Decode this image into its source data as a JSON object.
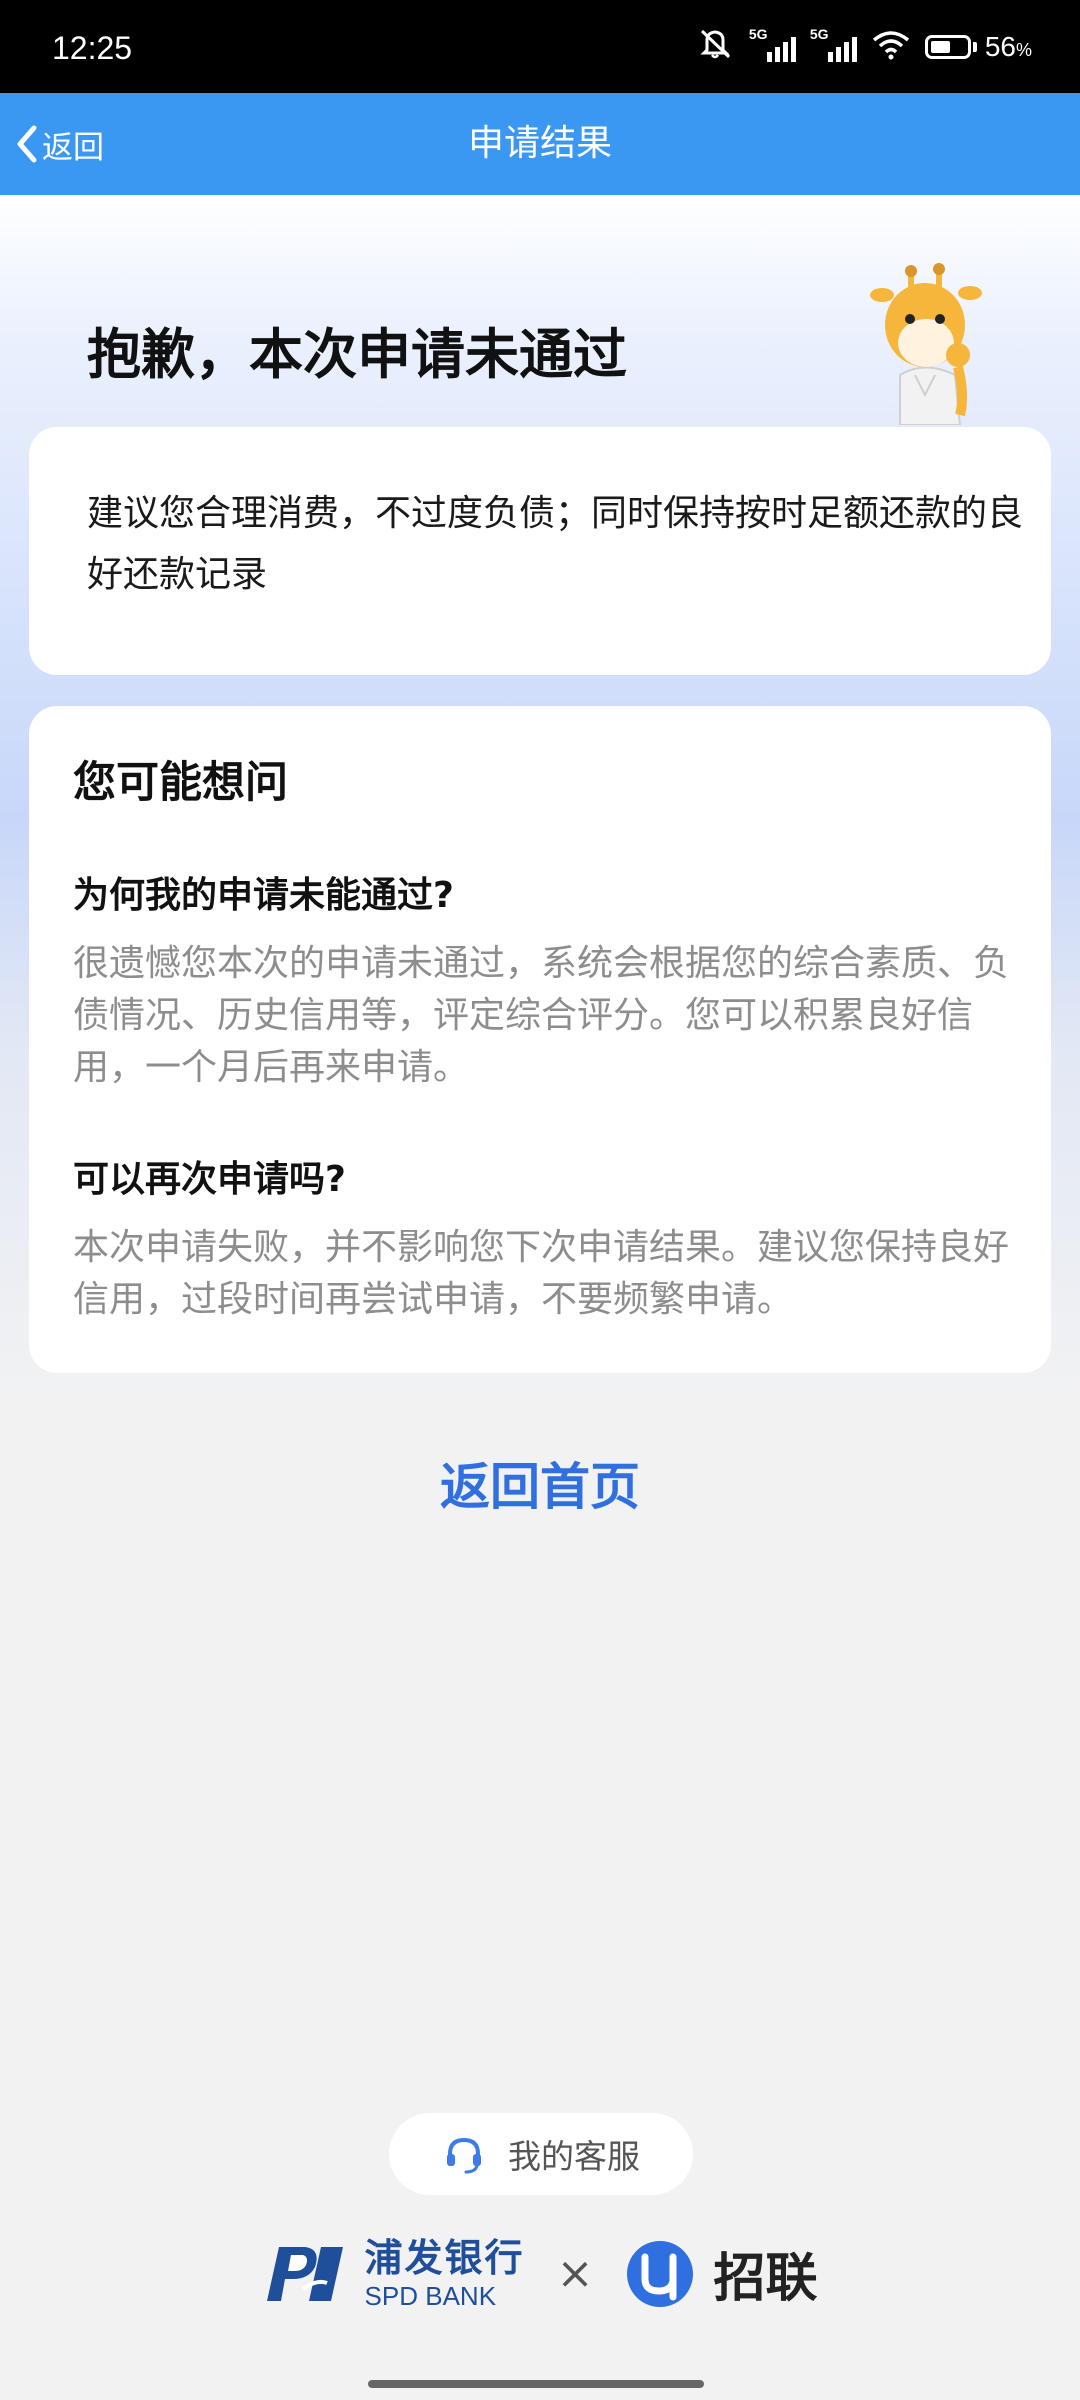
{
  "status_bar": {
    "time": "12:25",
    "network_1": "5G",
    "network_2": "5G",
    "battery_percent": "56",
    "battery_unit": "%",
    "battery_level": 0.56
  },
  "nav": {
    "back_label": "返回",
    "title": "申请结果",
    "color": "#3a98f3"
  },
  "result": {
    "headline": "抱歉，本次申请未通过",
    "tip": "建议您合理消费，不过度负债；同时保持按时足额还款的良好还款记录"
  },
  "faq": {
    "title": "您可能想问",
    "items": [
      {
        "question": "为何我的申请未能通过?",
        "answer": "很遗憾您本次的申请未通过，系统会根据您的综合素质、负债情况、历史信用等，评定综合评分。您可以积累良好信用，一个月后再来申请。"
      },
      {
        "question": "可以再次申请吗?",
        "answer": "本次申请失败，并不影响您下次申请结果。建议您保持良好信用，过段时间再尝试申请，不要频繁申请。"
      }
    ]
  },
  "actions": {
    "home_label": "返回首页",
    "service_label": "我的客服",
    "accent": "#2f6fe0"
  },
  "footer": {
    "bank_name_cn": "浦发银行",
    "bank_name_en": "SPD BANK",
    "separator": "×",
    "partner_name": "招联",
    "bank_color": "#1f4e9a"
  },
  "icons": [
    "mute-icon",
    "signal-icon",
    "wifi-icon",
    "battery-icon",
    "back-chevron-icon",
    "headset-icon",
    "spd-logo",
    "zhaolian-logo",
    "giraffe-mascot"
  ]
}
